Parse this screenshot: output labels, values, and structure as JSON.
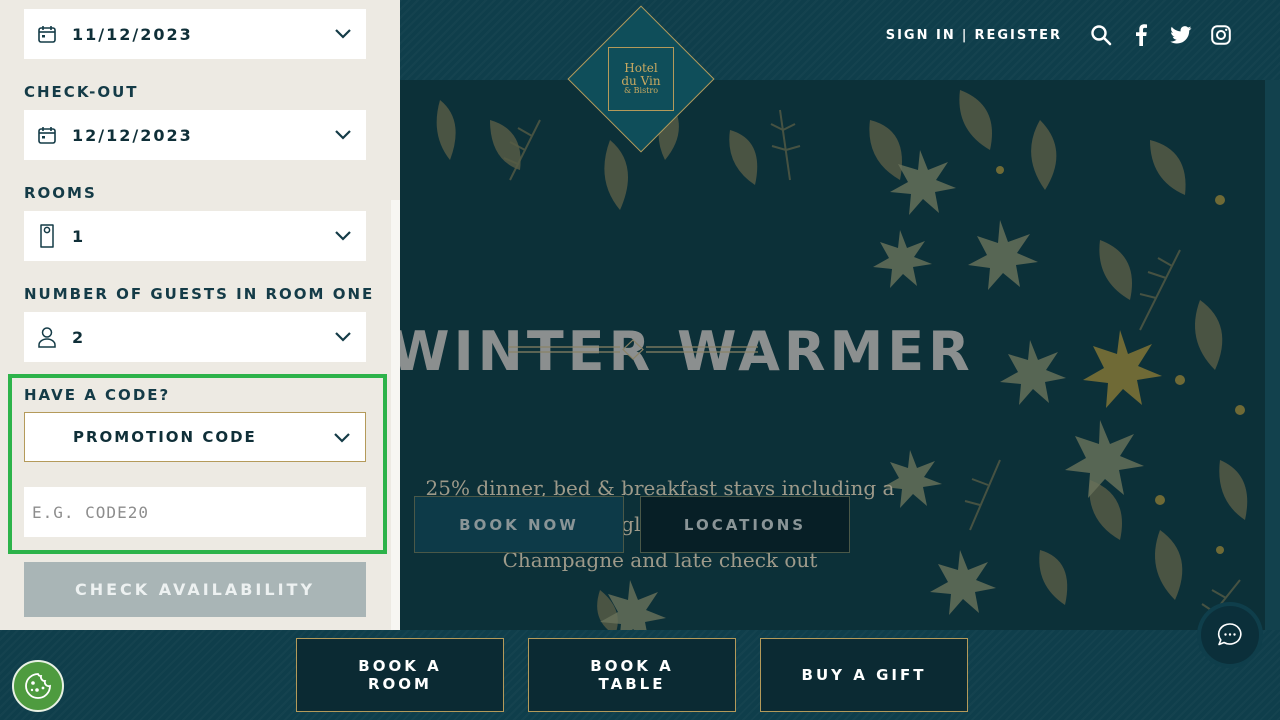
{
  "booking": {
    "checkin_value": "11/12/2023",
    "checkout_label": "CHECK-OUT",
    "checkout_value": "12/12/2023",
    "rooms_label": "ROOMS",
    "rooms_value": "1",
    "guests_label": "NUMBER OF GUESTS IN ROOM ONE",
    "guests_value": "2",
    "code_label": "HAVE A CODE?",
    "code_type_value": "PROMOTION CODE",
    "code_placeholder": "E.G. CODE20",
    "code_value": "",
    "check_button": "CHECK AVAILABILITY"
  },
  "header": {
    "sign_in": "SIGN IN",
    "separator": "|",
    "register": "REGISTER",
    "icons": [
      "search-icon",
      "facebook-icon",
      "twitter-icon",
      "instagram-icon"
    ]
  },
  "logo": {
    "line1": "Hotel",
    "line2": "du Vin",
    "line3": "& Bistro"
  },
  "hero": {
    "title": "WINTER WARMER",
    "description_line1": "25% dinner, bed & breakfast stays including a glass of",
    "description_line2": "Champagne and late check out",
    "book_now": "BOOK NOW",
    "locations": "LOCATIONS"
  },
  "footer": {
    "book_room": "BOOK A ROOM",
    "book_table": "BOOK A TABLE",
    "buy_gift": "BUY A GIFT"
  },
  "colors": {
    "brand_teal": "#0f3e4b",
    "gold": "#b49a5a",
    "panel_bg": "#edeae3",
    "highlight_green": "#2db34a"
  }
}
